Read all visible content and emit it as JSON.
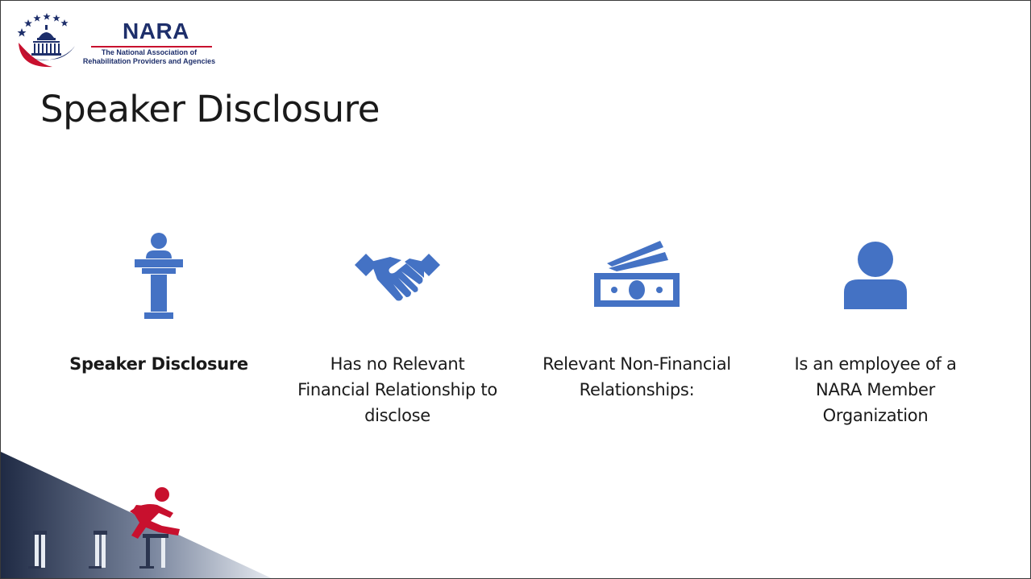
{
  "logo": {
    "name": "NARA",
    "tagline_line1": "The National Association of",
    "tagline_line2": "Rehabilitation Providers and Agencies"
  },
  "slide": {
    "title": "Speaker Disclosure"
  },
  "columns": [
    {
      "icon": "podium-speaker-icon",
      "label": "Speaker Disclosure",
      "bold": true
    },
    {
      "icon": "handshake-icon",
      "label": "Has no Relevant Financial Relationship to disclose",
      "bold": false
    },
    {
      "icon": "money-bills-icon",
      "label": "Relevant Non-Financial Relationships:",
      "bold": false
    },
    {
      "icon": "person-icon",
      "label": "Is an employee of a NARA Member Organization",
      "bold": false
    }
  ],
  "decoration": {
    "icon": "hurdler-icon"
  },
  "colors": {
    "icon_blue": "#4472c4",
    "brand_navy": "#1e2f6b",
    "brand_red": "#c8102e",
    "corner_dark": "#1f2a44"
  }
}
